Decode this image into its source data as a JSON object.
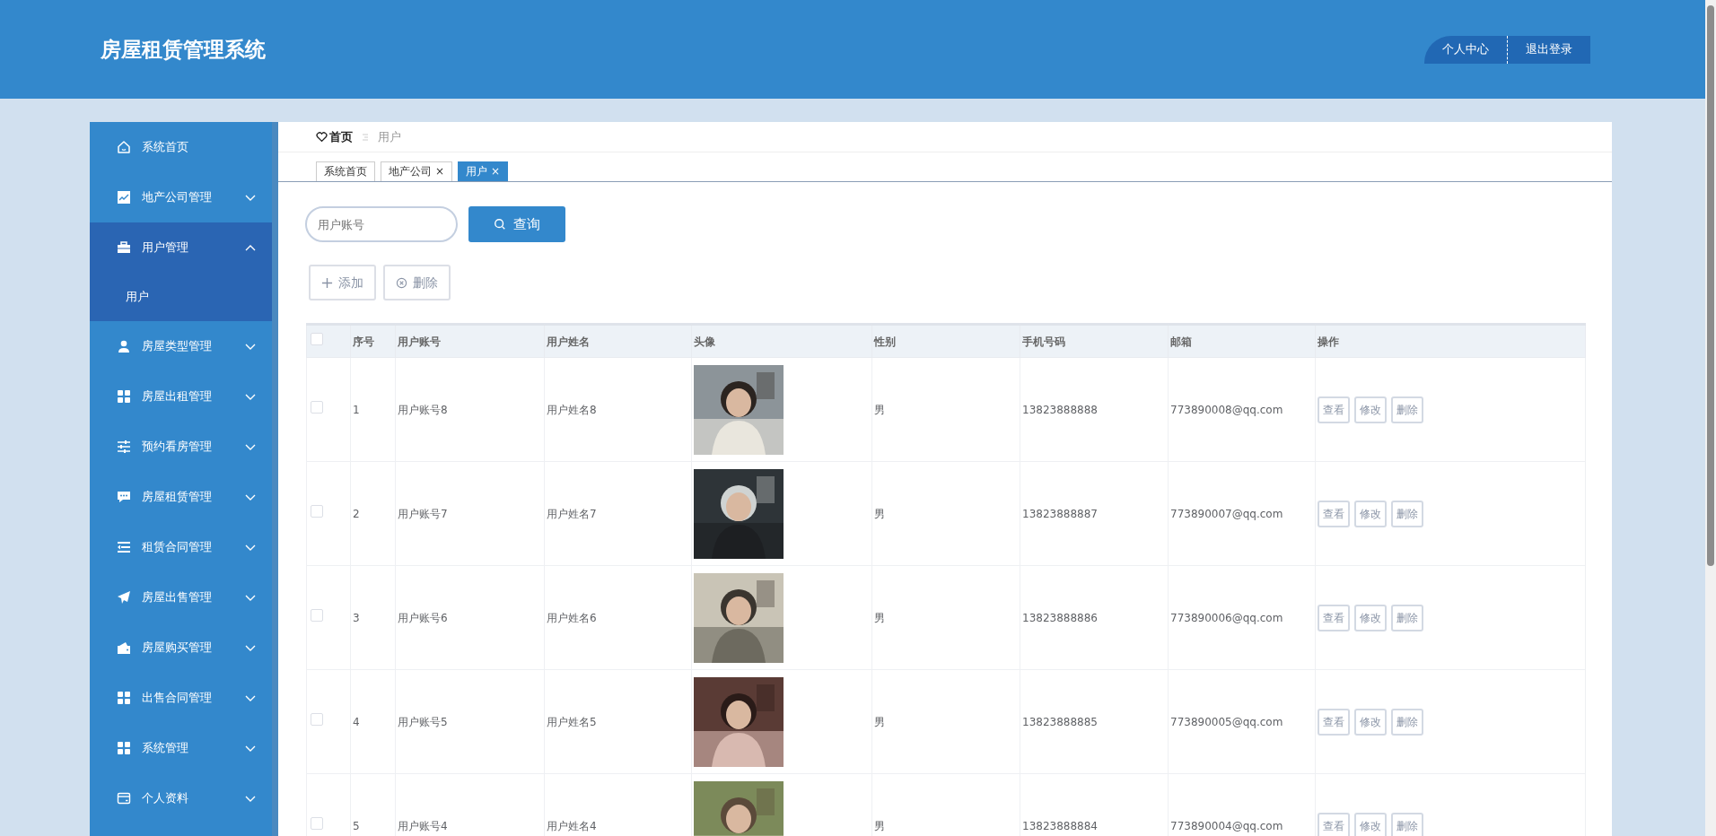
{
  "header": {
    "title": "房屋租赁管理系统",
    "buttons": [
      "个人中心",
      "退出登录"
    ]
  },
  "sidebar": {
    "items": [
      {
        "label": "系统首页"
      },
      {
        "label": "地产公司管理",
        "expanded": false
      },
      {
        "label": "用户管理",
        "expanded": true,
        "children": [
          {
            "label": "用户",
            "selected": true
          }
        ]
      },
      {
        "label": "房屋类型管理",
        "expanded": false
      },
      {
        "label": "房屋出租管理",
        "expanded": false
      },
      {
        "label": "预约看房管理",
        "expanded": false
      },
      {
        "label": "房屋租赁管理",
        "expanded": false
      },
      {
        "label": "租赁合同管理",
        "expanded": false
      },
      {
        "label": "房屋出售管理",
        "expanded": false
      },
      {
        "label": "房屋购买管理",
        "expanded": false
      },
      {
        "label": "出售合同管理",
        "expanded": false
      },
      {
        "label": "系统管理",
        "expanded": false
      },
      {
        "label": "个人资料",
        "expanded": false
      }
    ]
  },
  "breadcrumb": [
    "首页",
    "用户"
  ],
  "tabs": [
    {
      "label": "系统首页",
      "selected": false
    },
    {
      "label": "地产公司",
      "close": "×",
      "selected": false
    },
    {
      "label": "用户",
      "close": "×",
      "selected": true
    }
  ],
  "search": {
    "placeholder": "用户账号",
    "button": "查询"
  },
  "actions": [
    {
      "label": "添加",
      "kind": "add"
    },
    {
      "label": "删除",
      "kind": "delete"
    }
  ],
  "table": {
    "select_all_checked": false,
    "columns": [
      "序号",
      "用户账号",
      "用户姓名",
      "头像",
      "性别",
      "手机号码",
      "邮箱",
      "操作"
    ],
    "rows": [
      {
        "checked": false,
        "cells": [
          "1",
          "用户账号8",
          "用户姓名8",
          {
            "kind": "picture"
          },
          "男",
          "13823888888",
          "773890008@qq.com"
        ],
        "row_actions": [
          "查看",
          "修改",
          "删除"
        ]
      },
      {
        "checked": false,
        "cells": [
          "2",
          "用户账号7",
          "用户姓名7",
          {
            "kind": "picture"
          },
          "男",
          "13823888887",
          "773890007@qq.com"
        ],
        "row_actions": [
          "查看",
          "修改",
          "删除"
        ]
      },
      {
        "checked": false,
        "cells": [
          "3",
          "用户账号6",
          "用户姓名6",
          {
            "kind": "picture"
          },
          "男",
          "13823888886",
          "773890006@qq.com"
        ],
        "row_actions": [
          "查看",
          "修改",
          "删除"
        ]
      },
      {
        "checked": false,
        "cells": [
          "4",
          "用户账号5",
          "用户姓名5",
          {
            "kind": "picture"
          },
          "男",
          "13823888885",
          "773890005@qq.com"
        ],
        "row_actions": [
          "查看",
          "修改",
          "删除"
        ]
      },
      {
        "checked": false,
        "cells": [
          "5",
          "用户账号4",
          "用户姓名4",
          {
            "kind": "picture"
          },
          "男",
          "13823888884",
          "773890004@qq.com"
        ],
        "row_actions": [
          "查看",
          "修改",
          "删除"
        ]
      }
    ]
  }
}
